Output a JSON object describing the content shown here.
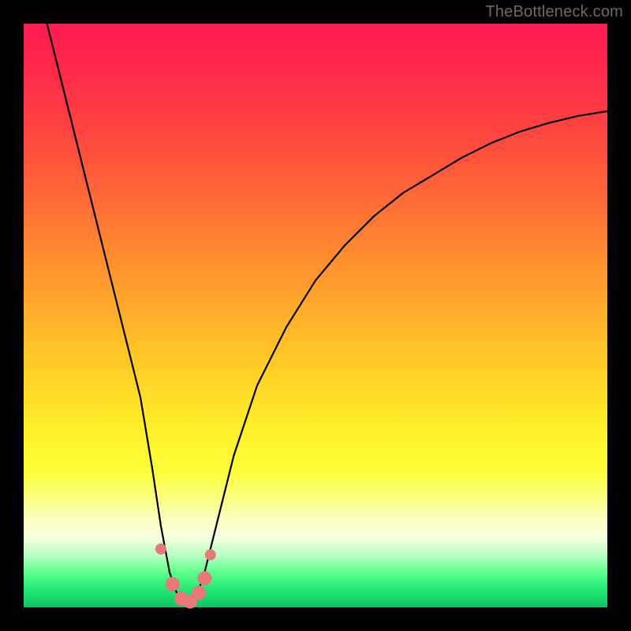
{
  "watermark": "TheBottleneck.com",
  "colors": {
    "background": "#000000",
    "gradient_top": "#ff1a52",
    "gradient_mid": "#ffd226",
    "gradient_bottom": "#10c460",
    "curve": "#000000",
    "marker": "#e77a78"
  },
  "chart_data": {
    "type": "line",
    "title": "",
    "xlabel": "",
    "ylabel": "",
    "xlim": [
      0,
      100
    ],
    "ylim": [
      0,
      100
    ],
    "grid": false,
    "legend": false,
    "series": [
      {
        "name": "bottleneck-curve",
        "x": [
          4,
          6,
          8,
          10,
          12,
          14,
          16,
          18,
          20,
          22,
          23.5,
          25,
          26,
          27,
          28,
          29,
          30,
          31,
          32,
          34,
          36,
          40,
          45,
          50,
          55,
          60,
          65,
          70,
          75,
          80,
          85,
          90,
          95,
          100
        ],
        "y": [
          100,
          92,
          84,
          76,
          68,
          60,
          52,
          44,
          36,
          24,
          14,
          6,
          3,
          1,
          0.5,
          1,
          3,
          6,
          10,
          18,
          26,
          38,
          48,
          56,
          62,
          67,
          71,
          74,
          77,
          79.5,
          81.5,
          83,
          84.2,
          85
        ]
      }
    ],
    "markers": {
      "name": "highlight-points",
      "x": [
        23.5,
        25.5,
        27,
        28.5,
        30,
        31,
        32
      ],
      "y": [
        10,
        4,
        1.5,
        1,
        2.5,
        5,
        9
      ]
    }
  }
}
